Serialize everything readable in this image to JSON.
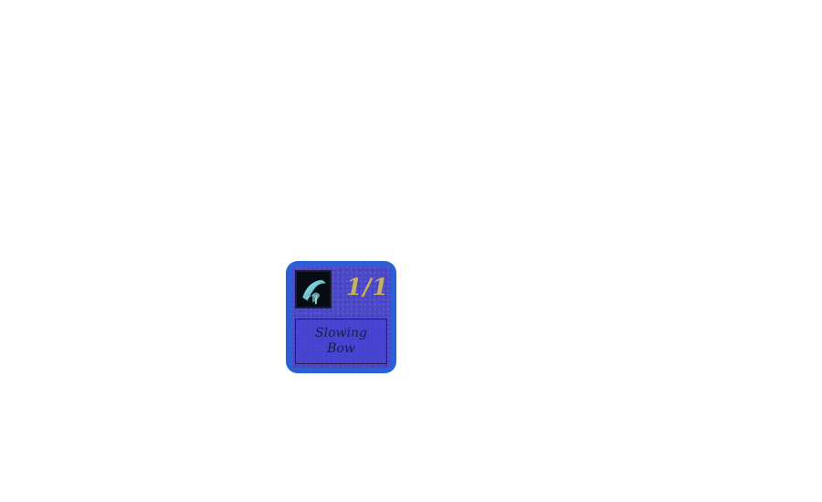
{
  "card": {
    "stat": "1/1",
    "name_line_1": "Slowing",
    "name_line_2": "Bow",
    "portrait_icon": "slowing-bow-icon",
    "colors": {
      "frame": "#2a60d6",
      "panel": "#4a47c9",
      "stat_text": "#c8b25a",
      "name_text": "#1c1c48"
    }
  }
}
